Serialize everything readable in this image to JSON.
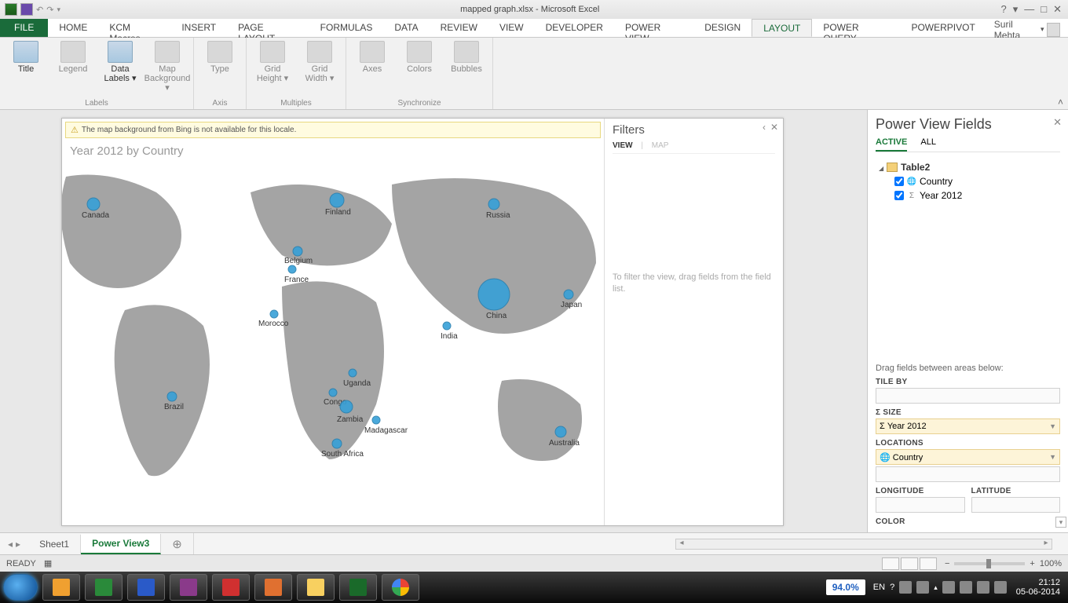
{
  "title": "mapped graph.xlsx - Microsoft Excel",
  "user": "Suril Mehta",
  "ribbonTabs": {
    "file": "FILE",
    "list": [
      "HOME",
      "KCM Macros",
      "INSERT",
      "PAGE LAYOUT",
      "FORMULAS",
      "DATA",
      "REVIEW",
      "VIEW",
      "DEVELOPER",
      "POWER VIEW",
      "DESIGN",
      "LAYOUT",
      "POWER QUERY",
      "POWERPIVOT"
    ],
    "active": "LAYOUT"
  },
  "ribbonGroups": {
    "labels": {
      "name": "Labels",
      "btns": [
        "Title",
        "Legend",
        "Data Labels ▾",
        "Map Background ▾"
      ]
    },
    "axis": {
      "name": "Axis",
      "btns": [
        "Type"
      ]
    },
    "multiples": {
      "name": "Multiples",
      "btns": [
        "Grid Height ▾",
        "Grid Width ▾"
      ]
    },
    "sync": {
      "name": "Synchronize",
      "btns": [
        "Axes",
        "Colors",
        "Bubbles"
      ]
    }
  },
  "warning": "The map background from Bing is not available for this locale.",
  "mapTitle": "Year 2012 by Country",
  "filters": {
    "title": "Filters",
    "tabs": {
      "view": "VIEW",
      "map": "MAP"
    },
    "hint": "To filter the view, drag fields from the field list."
  },
  "fieldList": {
    "title": "Power View Fields",
    "tabs": {
      "active": "ACTIVE",
      "all": "ALL"
    },
    "table": "Table2",
    "fields": [
      {
        "icon": "🌐",
        "label": "Country",
        "checked": true
      },
      {
        "icon": "Σ",
        "label": "Year 2012",
        "checked": true
      }
    ],
    "areasHeader": "Drag fields between areas below:",
    "areas": {
      "tileBy": "TILE BY",
      "size": "Σ SIZE",
      "sizeVal": "Σ Year 2012",
      "locations": "LOCATIONS",
      "locationsVal": "🌐 Country",
      "longitude": "LONGITUDE",
      "latitude": "LATITUDE",
      "color": "COLOR"
    }
  },
  "chart_data": {
    "type": "bubble-map",
    "title": "Year 2012 by Country",
    "size_field": "Year 2012",
    "location_field": "Country",
    "points": [
      {
        "country": "Canada",
        "size_rel": 0.35
      },
      {
        "country": "Finland",
        "size_rel": 0.4
      },
      {
        "country": "Russia",
        "size_rel": 0.3
      },
      {
        "country": "Belgium",
        "size_rel": 0.28
      },
      {
        "country": "France",
        "size_rel": 0.25
      },
      {
        "country": "Morocco",
        "size_rel": 0.22
      },
      {
        "country": "India",
        "size_rel": 0.2
      },
      {
        "country": "China",
        "size_rel": 1.0
      },
      {
        "country": "Japan",
        "size_rel": 0.25
      },
      {
        "country": "Uganda",
        "size_rel": 0.22
      },
      {
        "country": "Congo",
        "size_rel": 0.22
      },
      {
        "country": "Zambia",
        "size_rel": 0.35
      },
      {
        "country": "Madagascar",
        "size_rel": 0.2
      },
      {
        "country": "South Africa",
        "size_rel": 0.25
      },
      {
        "country": "Brazil",
        "size_rel": 0.25
      },
      {
        "country": "Australia",
        "size_rel": 0.3
      }
    ]
  },
  "sheets": {
    "s1": "Sheet1",
    "s2": "Power View3"
  },
  "status": {
    "ready": "READY",
    "zoom": "100%"
  },
  "taskbar": {
    "badge": "94.0%",
    "lang": "EN",
    "time": "21:12",
    "date": "05-06-2014"
  }
}
